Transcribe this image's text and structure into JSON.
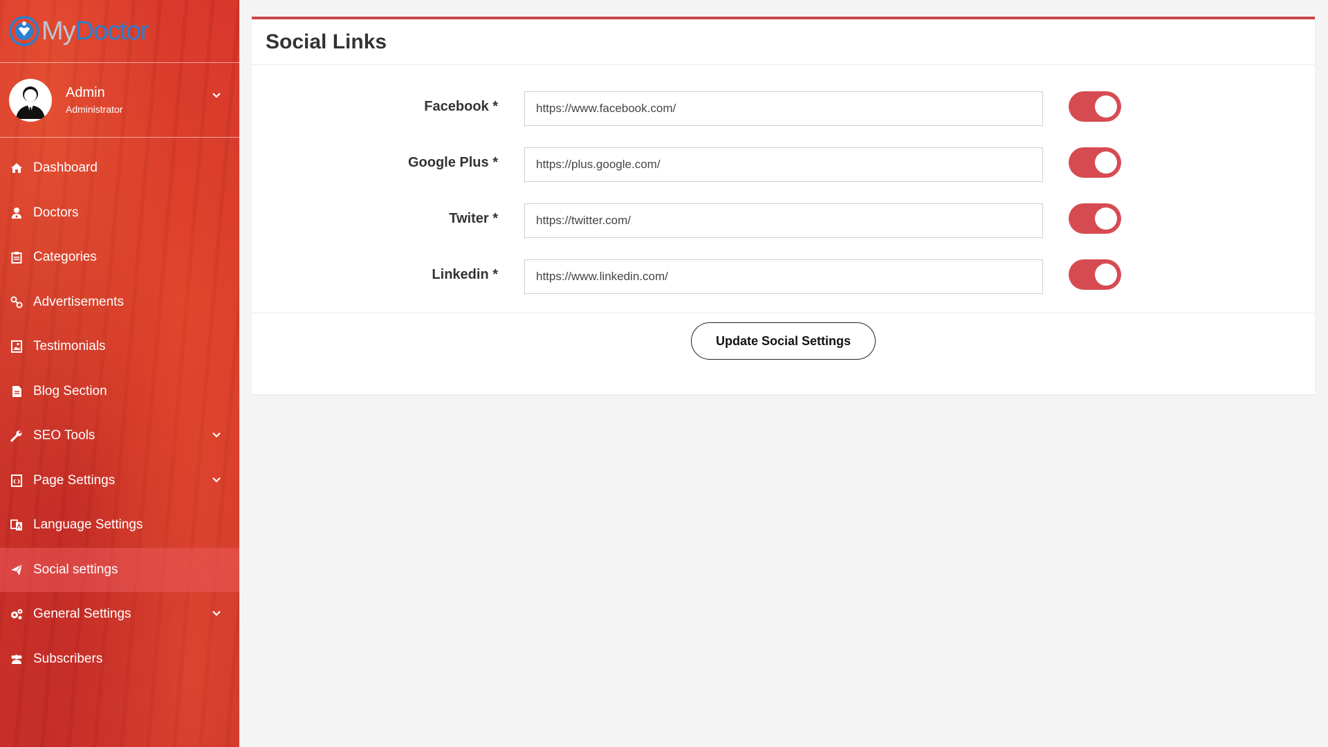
{
  "brand": {
    "part1": "My",
    "part2": "Doctor"
  },
  "user": {
    "name": "Admin",
    "role": "Administrator"
  },
  "menu": [
    {
      "label": "Dashboard",
      "icon": "home-icon"
    },
    {
      "label": "Doctors",
      "icon": "doctor-icon"
    },
    {
      "label": "Categories",
      "icon": "clipboard-icon"
    },
    {
      "label": "Advertisements",
      "icon": "link-icon"
    },
    {
      "label": "Testimonials",
      "icon": "image-icon"
    },
    {
      "label": "Blog Section",
      "icon": "document-icon"
    },
    {
      "label": "SEO Tools",
      "icon": "wrench-icon"
    },
    {
      "label": "Page Settings",
      "icon": "code-file-icon"
    },
    {
      "label": "Language Settings",
      "icon": "language-icon"
    },
    {
      "label": "Social settings",
      "icon": "paper-plane-icon",
      "active": true
    },
    {
      "label": "General Settings",
      "icon": "cogs-icon"
    },
    {
      "label": "Subscribers",
      "icon": "users-icon"
    }
  ],
  "page": {
    "title": "Social Links",
    "fields": [
      {
        "label": "Facebook *",
        "value": "https://www.facebook.com/",
        "enabled": true
      },
      {
        "label": "Google Plus *",
        "value": "https://plus.google.com/",
        "enabled": true
      },
      {
        "label": "Twiter *",
        "value": "https://twitter.com/",
        "enabled": true
      },
      {
        "label": "Linkedin *",
        "value": "https://www.linkedin.com/",
        "enabled": true
      }
    ],
    "submit_label": "Update Social Settings"
  },
  "colors": {
    "accent": "#d64b52",
    "sidebar": "#d23a2c",
    "brand_blue": "#2a7fd0"
  }
}
